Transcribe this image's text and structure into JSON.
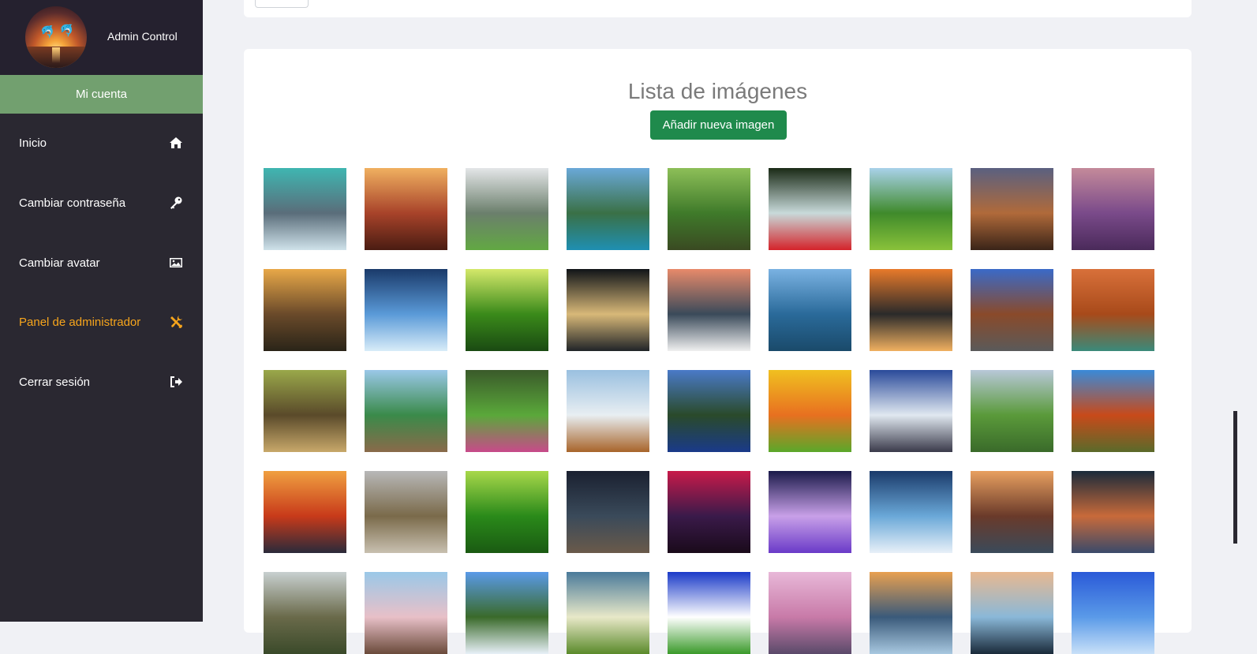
{
  "sidebar": {
    "admin_name": "Admin Control",
    "account_label": "Mi cuenta",
    "items": [
      {
        "label": "Inicio",
        "icon": "home-icon",
        "active": false
      },
      {
        "label": "Cambiar contraseña",
        "icon": "key-icon",
        "active": false
      },
      {
        "label": "Cambiar avatar",
        "icon": "image-icon",
        "active": false
      },
      {
        "label": "Panel de administrador",
        "icon": "tools-icon",
        "active": true
      },
      {
        "label": "Cerrar sesión",
        "icon": "sign-out-icon",
        "active": false
      }
    ]
  },
  "main": {
    "title": "Lista de imágenes",
    "add_button_label": "Añadir nueva imagen"
  },
  "colors": {
    "sidebar_bg": "#2a2831",
    "account_bar": "#72a06f",
    "active_item": "#f7a51c",
    "add_button": "#1f8a4c"
  },
  "images": [
    {
      "subject": "turquoise lake with mountains",
      "colors": [
        "#3fb6b1",
        "#5a6d7a",
        "#cfe2ea"
      ]
    },
    {
      "subject": "red canyon cliffs at sunset",
      "colors": [
        "#f0b060",
        "#a8432a",
        "#4a1c12"
      ]
    },
    {
      "subject": "misty mountain village path",
      "colors": [
        "#e4e6e8",
        "#6b7f6c",
        "#62a843"
      ]
    },
    {
      "subject": "tropical beach coastline",
      "colors": [
        "#6aa9d8",
        "#3a7046",
        "#1f8fb2"
      ]
    },
    {
      "subject": "green forest reflection",
      "colors": [
        "#8dbf58",
        "#3f7a2a",
        "#3a4a22"
      ]
    },
    {
      "subject": "fountain with red flowers",
      "colors": [
        "#1a2a16",
        "#c8dada",
        "#d4232a"
      ]
    },
    {
      "subject": "green valley lake",
      "colors": [
        "#a9d2ea",
        "#3f8a2b",
        "#89c23a"
      ]
    },
    {
      "subject": "canyon at dusk",
      "colors": [
        "#5a6080",
        "#b06a3a",
        "#3a2418"
      ]
    },
    {
      "subject": "lavender field sunset",
      "colors": [
        "#c48a9a",
        "#7a4a8a",
        "#4a2a5a"
      ]
    },
    {
      "subject": "winding valley road at sunset",
      "colors": [
        "#e8a848",
        "#6a4a2a",
        "#2a2418"
      ]
    },
    {
      "subject": "ice cave with person",
      "colors": [
        "#1a3a6a",
        "#5a9ad8",
        "#d8ecf8"
      ]
    },
    {
      "subject": "sunlit green forest",
      "colors": [
        "#d4e86a",
        "#3a8a1a",
        "#1a4a12"
      ]
    },
    {
      "subject": "full moon over sea",
      "colors": [
        "#101418",
        "#d8b878",
        "#202428"
      ]
    },
    {
      "subject": "daisies by mountain lake",
      "colors": [
        "#e88a6a",
        "#3a4a5a",
        "#f0f0f0"
      ]
    },
    {
      "subject": "mountain lake reflection",
      "colors": [
        "#7ab2e2",
        "#2a6a9a",
        "#1a4a6a"
      ]
    },
    {
      "subject": "palm trees at sunset",
      "colors": [
        "#e87a2a",
        "#2a2a2a",
        "#f0b060"
      ]
    },
    {
      "subject": "desert highway",
      "colors": [
        "#3a6ac8",
        "#8a4a2a",
        "#5a5a5a"
      ]
    },
    {
      "subject": "red rock canyon river",
      "colors": [
        "#d8703a",
        "#a84a1a",
        "#3a8a7a"
      ]
    },
    {
      "subject": "bear by water in forest",
      "colors": [
        "#9aa84a",
        "#5a4a2a",
        "#c8a86a"
      ]
    },
    {
      "subject": "wooden pier forest lake",
      "colors": [
        "#9ac8e8",
        "#3a8a4a",
        "#8a6a4a"
      ]
    },
    {
      "subject": "garden lawn with flowers",
      "colors": [
        "#3a5a2a",
        "#5aa83a",
        "#c84a8a"
      ]
    },
    {
      "subject": "snowy peaks over fields",
      "colors": [
        "#9ac0e0",
        "#e8eef2",
        "#a8642a"
      ]
    },
    {
      "subject": "lake with forested hills",
      "colors": [
        "#4a7ac8",
        "#2a4a2a",
        "#1a3a8a"
      ]
    },
    {
      "subject": "autumn tree painting",
      "colors": [
        "#f0c020",
        "#e87020",
        "#5aa82a"
      ]
    },
    {
      "subject": "snowy mountain cabin",
      "colors": [
        "#2a4a9a",
        "#e0e8f0",
        "#3a3a4a"
      ]
    },
    {
      "subject": "green field bench under clouds",
      "colors": [
        "#b8c8d8",
        "#5a9a3a",
        "#3a6a2a"
      ]
    },
    {
      "subject": "uluru red rock",
      "colors": [
        "#3a8ad8",
        "#c84a1a",
        "#5a6a2a"
      ]
    },
    {
      "subject": "torii gate at sunset",
      "colors": [
        "#f0a040",
        "#c83a1a",
        "#2a2a3a"
      ]
    },
    {
      "subject": "wooden boardwalk hillside",
      "colors": [
        "#b8b8b8",
        "#7a6a4a",
        "#c8c0b0"
      ]
    },
    {
      "subject": "sunny green forest",
      "colors": [
        "#a8d84a",
        "#2a8a1a",
        "#1a5a12"
      ]
    },
    {
      "subject": "starry night beach",
      "colors": [
        "#1a2030",
        "#3a4a5a",
        "#6a5a4a"
      ]
    },
    {
      "subject": "tree under red nebula",
      "colors": [
        "#c81a4a",
        "#3a1a4a",
        "#1a0a1a"
      ]
    },
    {
      "subject": "fantasy light beams islands",
      "colors": [
        "#1a1a4a",
        "#c8a0e8",
        "#6a3ac8"
      ]
    },
    {
      "subject": "fantasy planet over water",
      "colors": [
        "#1a3a6a",
        "#6aa8d8",
        "#e8f0f8"
      ]
    },
    {
      "subject": "canal town at sunset",
      "colors": [
        "#e8a060",
        "#6a3a2a",
        "#3a4a5a"
      ]
    },
    {
      "subject": "mountain over dark lake",
      "colors": [
        "#1a2a3a",
        "#c86a3a",
        "#3a4a6a"
      ]
    },
    {
      "subject": "stone arch bridge",
      "colors": [
        "#c8d0d0",
        "#6a6a4a",
        "#3a4a2a"
      ]
    },
    {
      "subject": "windmills and tulips",
      "colors": [
        "#9ac8e8",
        "#e8c0c8",
        "#6a4a3a"
      ]
    },
    {
      "subject": "forest under blue sky",
      "colors": [
        "#5a9ae8",
        "#3a6a2a",
        "#e8f0f8"
      ]
    },
    {
      "subject": "green meadow under clouds",
      "colors": [
        "#4a7a9a",
        "#e8e8c8",
        "#5a8a2a"
      ]
    },
    {
      "subject": "sun over green hills",
      "colors": [
        "#1a3ac8",
        "#ffffff",
        "#3a9a2a"
      ]
    },
    {
      "subject": "pink sky with pine trees",
      "colors": [
        "#e8b8d8",
        "#c87aa8",
        "#5a4a6a"
      ]
    },
    {
      "subject": "sunset clouds over sea",
      "colors": [
        "#e8a050",
        "#3a5a7a",
        "#a8c8e0"
      ]
    },
    {
      "subject": "rock in ocean at sunset",
      "colors": [
        "#e8b890",
        "#8ab8d8",
        "#1a2a3a"
      ]
    },
    {
      "subject": "blue sky over sea",
      "colors": [
        "#2a5ad8",
        "#5a9ae8",
        "#c8e0f8"
      ]
    }
  ]
}
